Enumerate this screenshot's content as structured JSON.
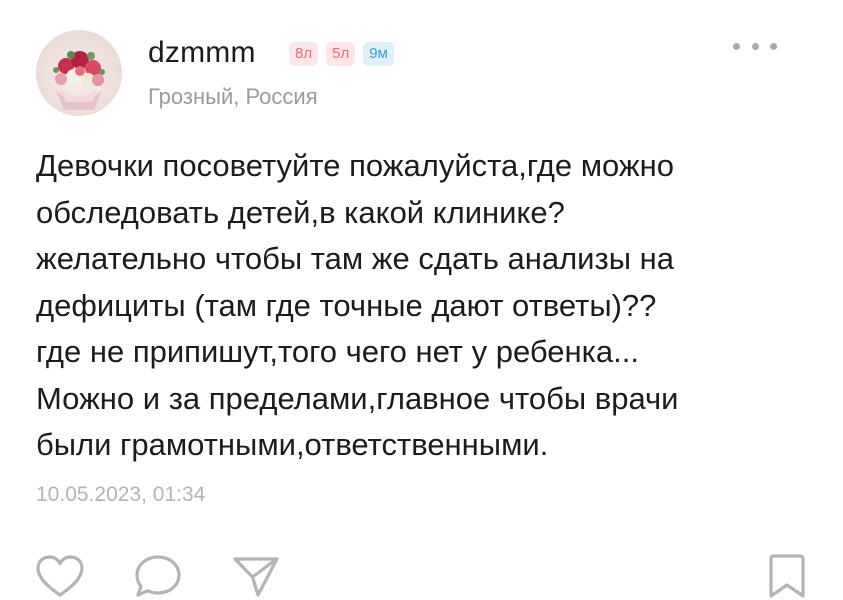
{
  "post": {
    "author": {
      "username": "dzmmm",
      "location": "Грозный, Россия",
      "avatar_icon": "flower-bouquet-avatar"
    },
    "badges": [
      {
        "label": "8л",
        "color": "#e96b7a",
        "bg": "#fde5e8"
      },
      {
        "label": "5л",
        "color": "#e96b7a",
        "bg": "#fde5e8"
      },
      {
        "label": "9м",
        "color": "#3c9bd6",
        "bg": "#dff0fb"
      }
    ],
    "text_lines": [
      "Девочки посоветуйте пожалуйста,где можно",
      "обследовать детей,в какой клинике?",
      "желательно чтобы там же сдать анализы на",
      "дефициты (там где точные дают ответы)??",
      "где не припишут,того чего нет у ребенка...",
      "Можно и за пределами,главное чтобы врачи",
      "были грамотными,ответственными."
    ],
    "timestamp": "10.05.2023, 01:34"
  },
  "actions": {
    "like_icon": "heart-icon",
    "comment_icon": "comment-bubble-icon",
    "share_icon": "send-arrow-icon",
    "bookmark_icon": "bookmark-icon",
    "more_icon": "more-dots-icon",
    "icon_color": "#b3b3b8"
  }
}
